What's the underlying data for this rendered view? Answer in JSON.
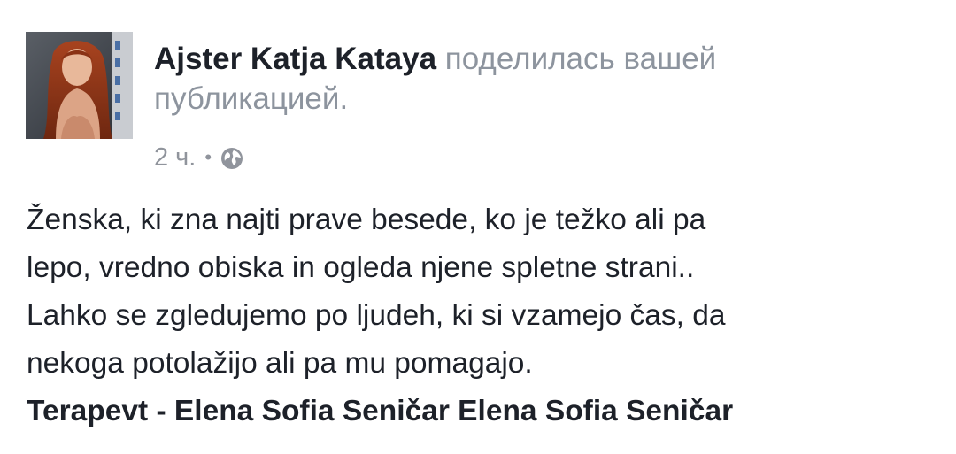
{
  "post": {
    "author_name": "Ajster Katja Kataya",
    "action_text": "поделилась вашей публикацией.",
    "timestamp": "2 ч.",
    "separator": "•",
    "audience_icon": "globe-icon",
    "avatar_icon": "profile-photo",
    "body_lines": [
      "Ženska, ki zna najti prave besede, ko je težko ali pa",
      "lepo, vredno obiska in ogleda njene spletne strani..",
      "Lahko se zgledujemo po ljudeh, ki si vzamejo čas, da",
      "nekoga potolažijo ali pa mu pomagajo."
    ],
    "signature": "Terapevt - Elena Sofia Seničar Elena Sofia Seničar"
  },
  "colors": {
    "text_primary": "#1d2129",
    "text_secondary": "#8d949e",
    "background": "#ffffff"
  }
}
